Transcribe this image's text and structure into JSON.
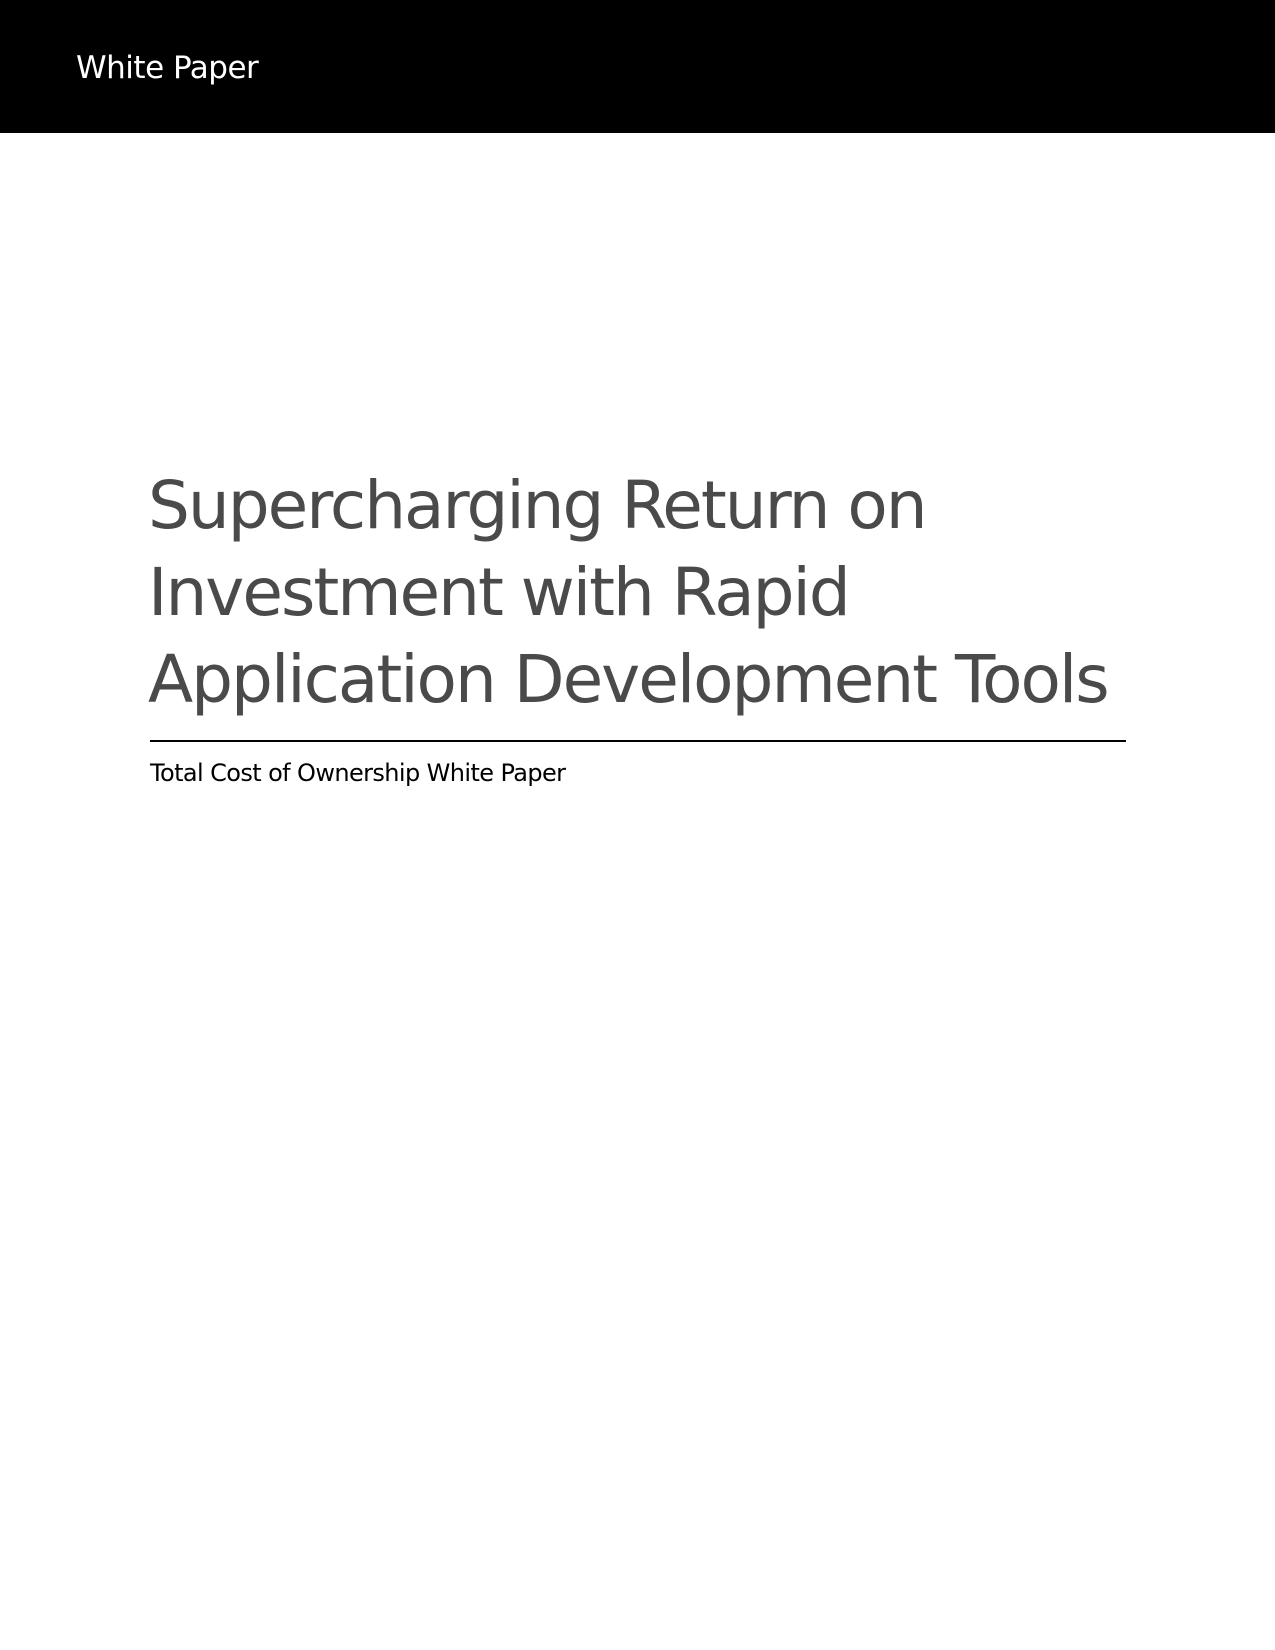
{
  "header": {
    "label": "White Paper",
    "background_color": "#000000",
    "text_color": "#ffffff"
  },
  "document": {
    "title_lines": [
      "Supercharging Return on",
      "Investment with Rapid",
      "Application Development Tools"
    ],
    "title_color": "#4a4a4a",
    "subtitle": "Total Cost of Ownership White Paper"
  }
}
